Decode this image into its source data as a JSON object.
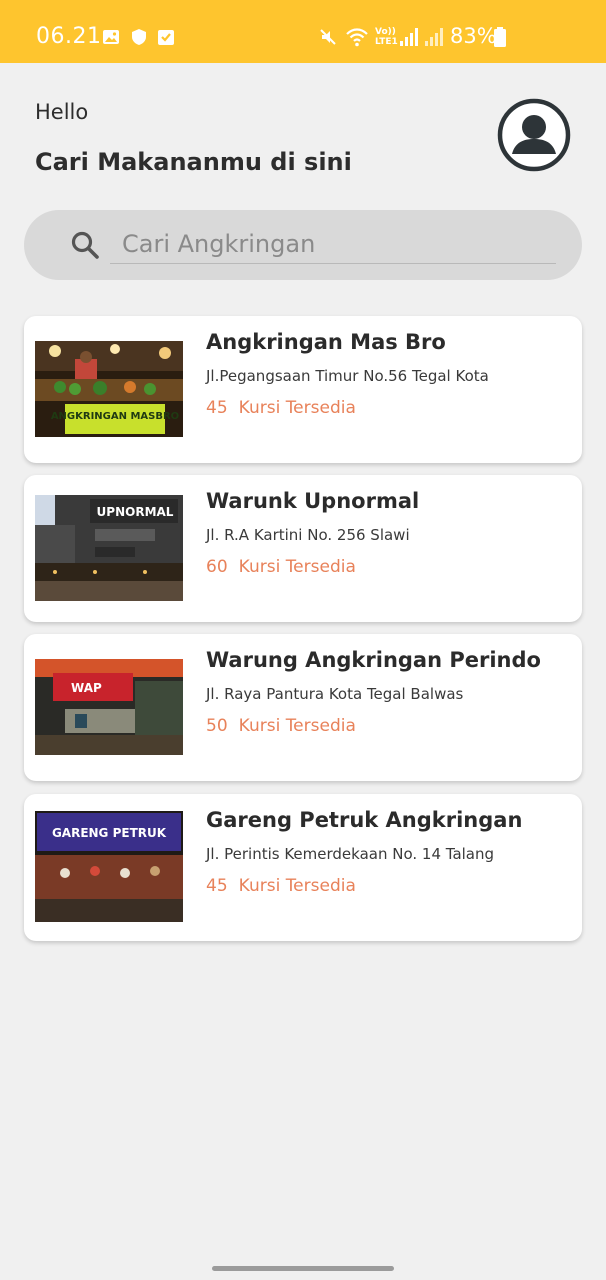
{
  "status_bar": {
    "time": "06.21",
    "battery": "83%",
    "network_label": "Vo)) LTE1"
  },
  "header": {
    "greeting": "Hello",
    "title": "Cari Makananmu di sini"
  },
  "search": {
    "placeholder": "Cari Angkringan"
  },
  "seats_label": "Kursi Tersedia",
  "colors": {
    "status_bar": "#fec52e",
    "background": "#f0f0f0",
    "seats_text": "#e8825a",
    "search_bg": "#d9d9d9"
  },
  "places": [
    {
      "name": "Angkringan Mas Bro",
      "address": "Jl.Pegangsaan Timur No.56 Tegal Kota",
      "seats": "45",
      "sign_text": "ANGKRINGAN MASBRO"
    },
    {
      "name": "Warunk Upnormal",
      "address": "Jl. R.A Kartini No. 256 Slawi",
      "seats": "60",
      "sign_text": "UPNORMAL"
    },
    {
      "name": "Warung Angkringan Perindo",
      "address": "Jl. Raya Pantura Kota Tegal Balwas",
      "seats": "50",
      "sign_text": "WAP"
    },
    {
      "name": "Gareng Petruk Angkringan",
      "address": "Jl. Perintis Kemerdekaan No. 14 Talang",
      "seats": "45",
      "sign_text": "GARENG PETRUK"
    }
  ]
}
